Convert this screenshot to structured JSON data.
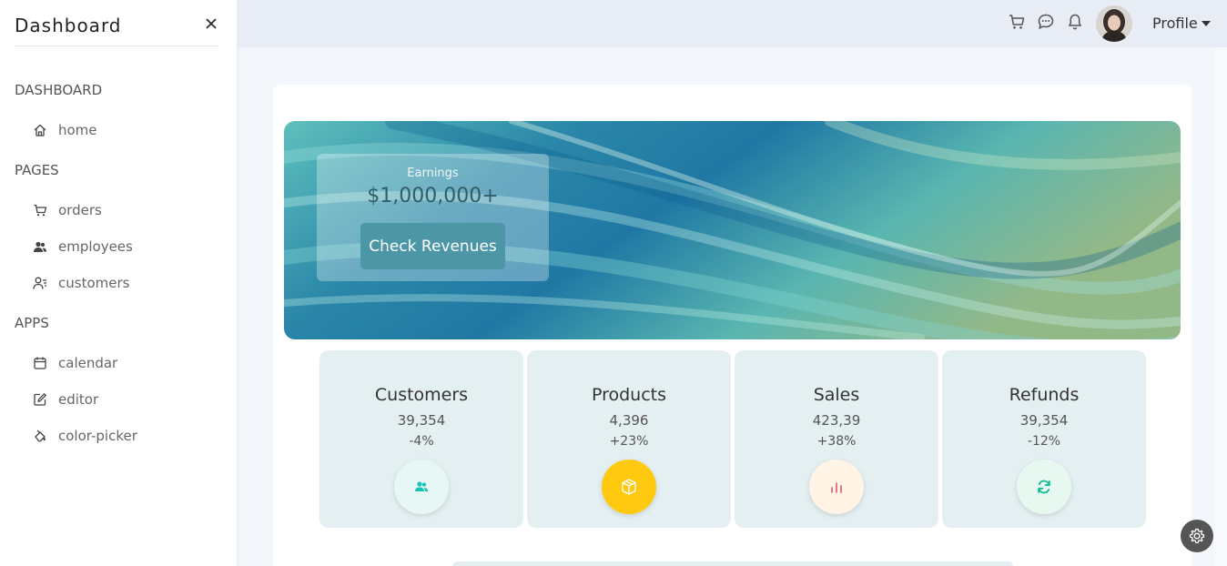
{
  "sidebar": {
    "title": "Dashboard",
    "sections": [
      {
        "label": "DASHBOARD",
        "items": [
          {
            "label": "home",
            "icon": "home-icon"
          }
        ]
      },
      {
        "label": "PAGES",
        "items": [
          {
            "label": "orders",
            "icon": "cart-icon"
          },
          {
            "label": "employees",
            "icon": "employees-icon"
          },
          {
            "label": "customers",
            "icon": "customers-icon"
          }
        ]
      },
      {
        "label": "APPS",
        "items": [
          {
            "label": "calendar",
            "icon": "calendar-icon"
          },
          {
            "label": "editor",
            "icon": "edit-icon"
          },
          {
            "label": "color-picker",
            "icon": "color-picker-icon"
          }
        ]
      }
    ]
  },
  "topbar": {
    "icons": [
      "cart-icon",
      "chat-icon",
      "bell-icon"
    ],
    "profile_label": "Profile"
  },
  "hero": {
    "earnings_label": "Earnings",
    "earnings_value": "$1,000,000+",
    "button_label": "Check Revenues"
  },
  "stats": [
    {
      "title": "Customers",
      "value": "39,354",
      "percent": "-4%",
      "icon": "customers-icon",
      "icon_color": "#1ac2b8",
      "icon_bg": "#e6f7f6"
    },
    {
      "title": "Products",
      "value": "4,396",
      "percent": "+23%",
      "icon": "box-icon",
      "icon_color": "#ffffff",
      "icon_bg": "#fec90f"
    },
    {
      "title": "Sales",
      "value": "423,39",
      "percent": "+38%",
      "icon": "bar-chart-icon",
      "icon_color": "#e46a76",
      "icon_bg": "#fff4e5"
    },
    {
      "title": "Refunds",
      "value": "39,354",
      "percent": "-12%",
      "icon": "refresh-icon",
      "icon_color": "#11b98f",
      "icon_bg": "#e7f8f1"
    }
  ],
  "colors": {
    "accent": "#4c96a5",
    "topbar_bg": "#e8edf5",
    "stat_card_bg": "#e4eff1"
  }
}
